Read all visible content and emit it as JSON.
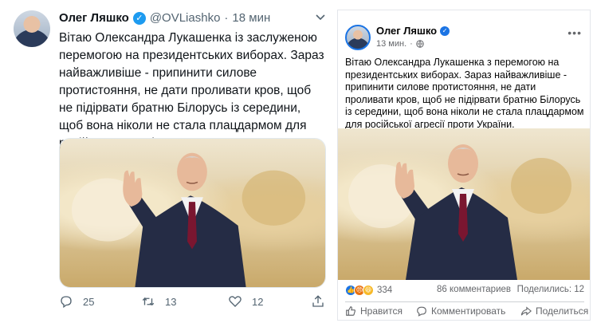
{
  "twitter": {
    "author_name": "Олег Ляшко",
    "handle": "@OVLiashko",
    "separator": "·",
    "time": "18 мин",
    "text": "Вітаю Олександра Лукашенка із заслуженою перемогою на президентських виборах. Зараз найважливіше - припинити силове протистояння, не дати проливати кров, щоб не підірвати братню Білорусь із середини, щоб вона ніколи не стала плацдармом для російської агресії проти України.",
    "replies": "25",
    "retweets": "13",
    "likes": "12",
    "icons": [
      "verified-badge-icon",
      "chevron-down-icon",
      "reply-icon",
      "retweet-icon",
      "like-icon",
      "share-icon"
    ],
    "accent": "#1d9bf0"
  },
  "facebook": {
    "author_name": "Олег Ляшко",
    "time": "13 мин.",
    "separator": "·",
    "more": "•••",
    "text": "Вітаю Олександра Лукашенка з перемогою на президентських виборах. Зараз найважливіше - припинити силове протистояння, не дати проливати кров, щоб не підірвати братню Білорусь із середини, щоб вона ніколи не стала плацдармом для російської агресії проти України.",
    "reactions_count": "334",
    "comments": "86 комментариев",
    "shares": "Поделились: 12",
    "like_label": "Нравится",
    "comment_label": "Комментировать",
    "share_label": "Поделиться",
    "icons": [
      "verified-badge-icon",
      "globe-icon",
      "like-reaction-icon",
      "angry-reaction-icon",
      "haha-reaction-icon",
      "thumb-up-icon",
      "comment-icon",
      "share-arrow-icon"
    ],
    "accent": "#1b74e4"
  }
}
